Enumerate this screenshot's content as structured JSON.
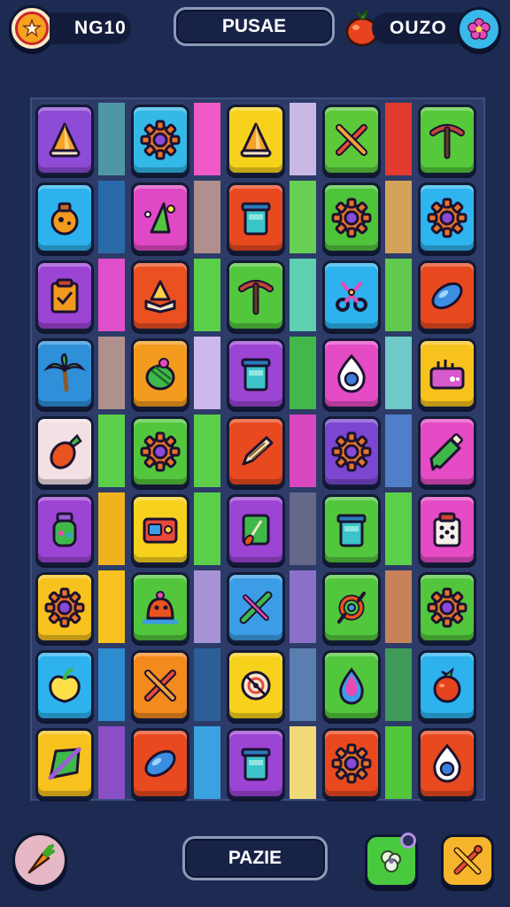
{
  "header": {
    "score_label": "NG10",
    "title": "PUSAE",
    "fruit_counter": "OUZO"
  },
  "footer": {
    "center_button_label": "PAZIE"
  },
  "colors": {
    "background": "#1d2a52",
    "board": "#2d3b68"
  },
  "board": {
    "columns": 5,
    "rows": 9,
    "tiles": [
      [
        "cone-icon",
        "gear-icon",
        "cone-icon",
        "crossed-tools-icon",
        "pickaxe-icon"
      ],
      [
        "potion-jar-icon",
        "magic-sparkle-icon",
        "trash-bin-icon",
        "gear-icon",
        "gear-icon"
      ],
      [
        "clipboard-icon",
        "pyramid-book-icon",
        "pickaxe-icon",
        "scissors-knot-icon",
        "seed-icon"
      ],
      [
        "palm-tree-icon",
        "melon-icon",
        "trash-bin-icon",
        "ring-drop-icon",
        "toolbox-icon"
      ],
      [
        "carrot-icon",
        "gear-icon",
        "pencil-icon",
        "gear-icon",
        "paint-tube-icon"
      ],
      [
        "jar-icon",
        "radio-icon",
        "shovel-icon",
        "trash-bin-icon",
        "dice-jar-icon"
      ],
      [
        "gear-icon",
        "creature-icon",
        "crossed-candy-icon",
        "knot-icon",
        "gear-icon"
      ],
      [
        "apple-icon",
        "crossed-tools-icon",
        "target-icon",
        "potion-drop-icon",
        "tomato-icon"
      ],
      [
        "kite-icon",
        "seed-icon",
        "trash-bin-icon",
        "gear-icon",
        "ring-drop-icon"
      ]
    ]
  }
}
